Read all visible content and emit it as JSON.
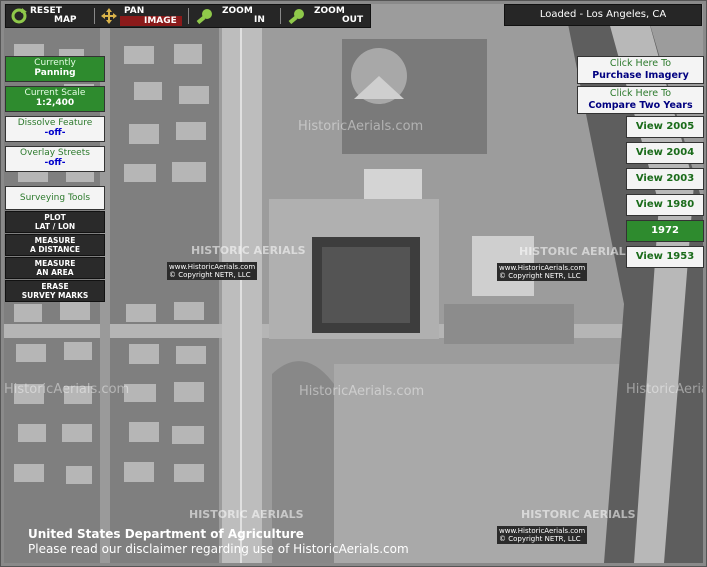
{
  "toolbar": {
    "reset": {
      "line1": "RESET",
      "line2": "MAP",
      "icon": "refresh-icon"
    },
    "pan": {
      "line1": "PAN",
      "line2": "IMAGE",
      "icon": "pan-arrows-icon"
    },
    "zoom_in": {
      "line1": "ZOOM",
      "line2": "IN",
      "icon": "magnifier-plus-icon"
    },
    "zoom_out": {
      "line1": "ZOOM",
      "line2": "OUT",
      "icon": "magnifier-minus-icon"
    }
  },
  "status": {
    "loaded": "Loaded - Los Angeles, CA"
  },
  "left_panel": {
    "currently": {
      "label": "Currently",
      "value": "Panning"
    },
    "scale": {
      "label": "Current Scale",
      "value": "1:2,400"
    },
    "dissolve": {
      "label": "Dissolve Feature",
      "value": "-off-"
    },
    "overlay": {
      "label": "Overlay Streets",
      "value": "-off-"
    },
    "surveying_title": "Surveying Tools",
    "tools": [
      {
        "line1": "PLOT",
        "line2": "LAT / LON"
      },
      {
        "line1": "MEASURE",
        "line2": "A DISTANCE"
      },
      {
        "line1": "MEASURE",
        "line2": "AN AREA"
      },
      {
        "line1": "ERASE",
        "line2": "SURVEY MARKS"
      }
    ]
  },
  "right_panel": {
    "purchase": {
      "line1": "Click Here To",
      "line2": "Purchase Imagery"
    },
    "compare": {
      "line1": "Click Here To",
      "line2": "Compare Two Years"
    },
    "years": [
      {
        "label": "View 2005",
        "active": false
      },
      {
        "label": "View 2004",
        "active": false
      },
      {
        "label": "View 2003",
        "active": false
      },
      {
        "label": "View 1980",
        "active": false
      },
      {
        "label": "1972",
        "active": true
      },
      {
        "label": "View 1953",
        "active": false
      }
    ]
  },
  "watermarks": {
    "site": "HistoricAerials.com",
    "brand": "HISTORIC AERIALS",
    "url": "www.HistoricAerials.com",
    "copyright": "© Copyright NETR, LLC"
  },
  "footer": {
    "agency": "United States Department of Agriculture",
    "disclaimer": "Please read our disclaimer regarding use of HistoricAerials.com"
  },
  "colors": {
    "accent_green": "#2e8b2e",
    "toolbar": "#262626",
    "link_blue": "#000080"
  }
}
